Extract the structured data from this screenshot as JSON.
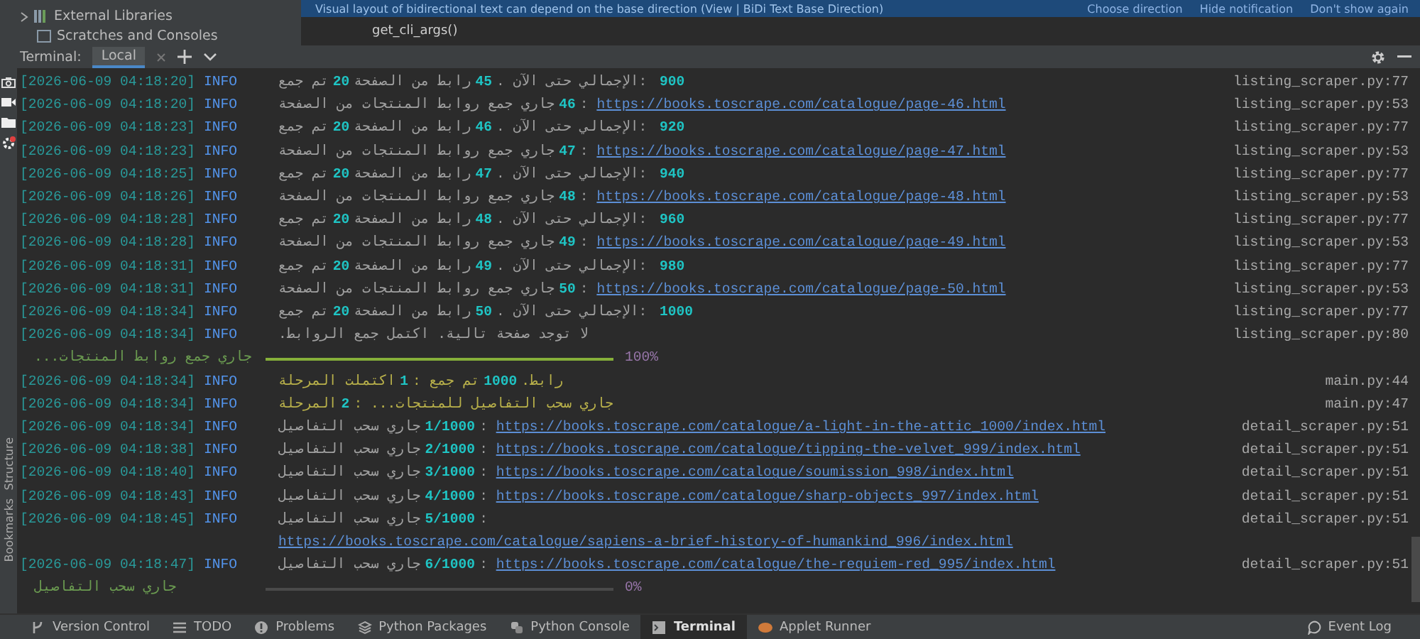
{
  "notification": {
    "text": "Visual layout of bidirectional text can depend on the base direction (View | BiDi Text Base Direction)",
    "actions": [
      "Choose direction",
      "Hide notification",
      "Don't show again"
    ]
  },
  "project_tree": {
    "items": [
      {
        "label": "External Libraries",
        "kind": "library"
      },
      {
        "label": "Scratches and Consoles",
        "kind": "scratch"
      }
    ]
  },
  "editor": {
    "code_line": "get_cli_args()"
  },
  "side_strip": {
    "tool_windows": [
      {
        "label": "Structure"
      },
      {
        "label": "Bookmarks"
      }
    ]
  },
  "terminal": {
    "title": "Terminal:",
    "tabs": [
      {
        "label": "Local",
        "selected": true
      }
    ],
    "log": [
      {
        "kind": "log",
        "highlighted": false,
        "time": "[2026-06-09 04:18:20]",
        "level": "INFO",
        "parts": [
          {
            "kind": "ar",
            "text": "تم جمع"
          },
          {
            "kind": "num",
            "text": "20"
          },
          {
            "kind": "ar",
            "text": "رابط من الصفحة"
          },
          {
            "kind": "num",
            "text": "45"
          },
          {
            "kind": "plain",
            "text": ". "
          },
          {
            "kind": "ar",
            "text": "الإجمالي حتى الآن"
          },
          {
            "kind": "plain",
            "text": ": "
          },
          {
            "kind": "num",
            "text": "900"
          }
        ],
        "source": "listing_scraper.py:77"
      },
      {
        "kind": "log",
        "highlighted": false,
        "time": "[2026-06-09 04:18:20]",
        "level": "INFO",
        "parts": [
          {
            "kind": "ar",
            "text": "جاري جمع روابط المنتجات من الصفحة"
          },
          {
            "kind": "num",
            "text": "46"
          },
          {
            "kind": "plain",
            "text": ": "
          },
          {
            "kind": "url",
            "text": "https://books.toscrape.com/catalogue/page-46.html"
          }
        ],
        "source": "listing_scraper.py:53"
      },
      {
        "kind": "log",
        "highlighted": false,
        "time": "[2026-06-09 04:18:23]",
        "level": "INFO",
        "parts": [
          {
            "kind": "ar",
            "text": "تم جمع"
          },
          {
            "kind": "num",
            "text": "20"
          },
          {
            "kind": "ar",
            "text": "رابط من الصفحة"
          },
          {
            "kind": "num",
            "text": "46"
          },
          {
            "kind": "plain",
            "text": ". "
          },
          {
            "kind": "ar",
            "text": "الإجمالي حتى الآن"
          },
          {
            "kind": "plain",
            "text": ": "
          },
          {
            "kind": "num",
            "text": "920"
          }
        ],
        "source": "listing_scraper.py:77"
      },
      {
        "kind": "log",
        "highlighted": false,
        "time": "[2026-06-09 04:18:23]",
        "level": "INFO",
        "parts": [
          {
            "kind": "ar",
            "text": "جاري جمع روابط المنتجات من الصفحة"
          },
          {
            "kind": "num",
            "text": "47"
          },
          {
            "kind": "plain",
            "text": ": "
          },
          {
            "kind": "url",
            "text": "https://books.toscrape.com/catalogue/page-47.html"
          }
        ],
        "source": "listing_scraper.py:53"
      },
      {
        "kind": "log",
        "highlighted": false,
        "time": "[2026-06-09 04:18:25]",
        "level": "INFO",
        "parts": [
          {
            "kind": "ar",
            "text": "تم جمع"
          },
          {
            "kind": "num",
            "text": "20"
          },
          {
            "kind": "ar",
            "text": "رابط من الصفحة"
          },
          {
            "kind": "num",
            "text": "47"
          },
          {
            "kind": "plain",
            "text": ". "
          },
          {
            "kind": "ar",
            "text": "الإجمالي حتى الآن"
          },
          {
            "kind": "plain",
            "text": ": "
          },
          {
            "kind": "num",
            "text": "940"
          }
        ],
        "source": "listing_scraper.py:77"
      },
      {
        "kind": "log",
        "highlighted": false,
        "time": "[2026-06-09 04:18:26]",
        "level": "INFO",
        "parts": [
          {
            "kind": "ar",
            "text": "جاري جمع روابط المنتجات من الصفحة"
          },
          {
            "kind": "num",
            "text": "48"
          },
          {
            "kind": "plain",
            "text": ": "
          },
          {
            "kind": "url",
            "text": "https://books.toscrape.com/catalogue/page-48.html"
          }
        ],
        "source": "listing_scraper.py:53"
      },
      {
        "kind": "log",
        "highlighted": false,
        "time": "[2026-06-09 04:18:28]",
        "level": "INFO",
        "parts": [
          {
            "kind": "ar",
            "text": "تم جمع"
          },
          {
            "kind": "num",
            "text": "20"
          },
          {
            "kind": "ar",
            "text": "رابط من الصفحة"
          },
          {
            "kind": "num",
            "text": "48"
          },
          {
            "kind": "plain",
            "text": ". "
          },
          {
            "kind": "ar",
            "text": "الإجمالي حتى الآن"
          },
          {
            "kind": "plain",
            "text": ": "
          },
          {
            "kind": "num",
            "text": "960"
          }
        ],
        "source": "listing_scraper.py:77"
      },
      {
        "kind": "log",
        "highlighted": false,
        "time": "[2026-06-09 04:18:28]",
        "level": "INFO",
        "parts": [
          {
            "kind": "ar",
            "text": "جاري جمع روابط المنتجات من الصفحة"
          },
          {
            "kind": "num",
            "text": "49"
          },
          {
            "kind": "plain",
            "text": ": "
          },
          {
            "kind": "url",
            "text": "https://books.toscrape.com/catalogue/page-49.html"
          }
        ],
        "source": "listing_scraper.py:53"
      },
      {
        "kind": "log",
        "highlighted": false,
        "time": "[2026-06-09 04:18:31]",
        "level": "INFO",
        "parts": [
          {
            "kind": "ar",
            "text": "تم جمع"
          },
          {
            "kind": "num",
            "text": "20"
          },
          {
            "kind": "ar",
            "text": "رابط من الصفحة"
          },
          {
            "kind": "num",
            "text": "49"
          },
          {
            "kind": "plain",
            "text": ". "
          },
          {
            "kind": "ar",
            "text": "الإجمالي حتى الآن"
          },
          {
            "kind": "plain",
            "text": ": "
          },
          {
            "kind": "num",
            "text": "980"
          }
        ],
        "source": "listing_scraper.py:77"
      },
      {
        "kind": "log",
        "highlighted": false,
        "time": "[2026-06-09 04:18:31]",
        "level": "INFO",
        "parts": [
          {
            "kind": "ar",
            "text": "جاري جمع روابط المنتجات من الصفحة"
          },
          {
            "kind": "num",
            "text": "50"
          },
          {
            "kind": "plain",
            "text": ": "
          },
          {
            "kind": "url",
            "text": "https://books.toscrape.com/catalogue/page-50.html"
          }
        ],
        "source": "listing_scraper.py:53"
      },
      {
        "kind": "log",
        "highlighted": false,
        "time": "[2026-06-09 04:18:34]",
        "level": "INFO",
        "parts": [
          {
            "kind": "ar",
            "text": "تم جمع"
          },
          {
            "kind": "num",
            "text": "20"
          },
          {
            "kind": "ar",
            "text": "رابط من الصفحة"
          },
          {
            "kind": "num",
            "text": "50"
          },
          {
            "kind": "plain",
            "text": ". "
          },
          {
            "kind": "ar",
            "text": "الإجمالي حتى الآن"
          },
          {
            "kind": "plain",
            "text": ": "
          },
          {
            "kind": "num",
            "text": "1000"
          }
        ],
        "source": "listing_scraper.py:77"
      },
      {
        "kind": "log",
        "highlighted": false,
        "time": "[2026-06-09 04:18:34]",
        "level": "INFO",
        "parts": [
          {
            "kind": "ar",
            "text": "لا توجد صفحة تالية. اكتمل جمع الروابط."
          }
        ],
        "source": "listing_scraper.py:80"
      },
      {
        "kind": "progress",
        "label": "جاري جمع روابط المنتجات...",
        "level": 1,
        "percent": "100%"
      },
      {
        "kind": "log",
        "highlighted": true,
        "time": "[2026-06-09 04:18:34]",
        "level": "INFO",
        "parts": [
          {
            "kind": "ar",
            "text": "اكتملت المرحلة"
          },
          {
            "kind": "num",
            "text": "1"
          },
          {
            "kind": "plain",
            "text": ": "
          },
          {
            "kind": "ar",
            "text": "تم جمع"
          },
          {
            "kind": "num",
            "text": "1000"
          },
          {
            "kind": "ar",
            "text": "رابط."
          }
        ],
        "source": "main.py:44"
      },
      {
        "kind": "log",
        "highlighted": true,
        "time": "[2026-06-09 04:18:34]",
        "level": "INFO",
        "parts": [
          {
            "kind": "ar",
            "text": "المرحلة"
          },
          {
            "kind": "num",
            "text": "2"
          },
          {
            "kind": "plain",
            "text": ": "
          },
          {
            "kind": "ar",
            "text": "جاري سحب التفاصيل للمنتجات..."
          }
        ],
        "source": "main.py:47"
      },
      {
        "kind": "log",
        "highlighted": false,
        "time": "[2026-06-09 04:18:34]",
        "level": "INFO",
        "parts": [
          {
            "kind": "ar",
            "text": "جاري سحب التفاصيل"
          },
          {
            "kind": "num",
            "text": "1/1000"
          },
          {
            "kind": "plain",
            "text": ": "
          },
          {
            "kind": "url",
            "text": "https://books.toscrape.com/catalogue/a-light-in-the-attic_1000/index.html"
          }
        ],
        "source": "detail_scraper.py:51"
      },
      {
        "kind": "log",
        "highlighted": false,
        "time": "[2026-06-09 04:18:38]",
        "level": "INFO",
        "parts": [
          {
            "kind": "ar",
            "text": "جاري سحب التفاصيل"
          },
          {
            "kind": "num",
            "text": "2/1000"
          },
          {
            "kind": "plain",
            "text": ": "
          },
          {
            "kind": "url",
            "text": "https://books.toscrape.com/catalogue/tipping-the-velvet_999/index.html"
          }
        ],
        "source": "detail_scraper.py:51"
      },
      {
        "kind": "log",
        "highlighted": false,
        "time": "[2026-06-09 04:18:40]",
        "level": "INFO",
        "parts": [
          {
            "kind": "ar",
            "text": "جاري سحب التفاصيل"
          },
          {
            "kind": "num",
            "text": "3/1000"
          },
          {
            "kind": "plain",
            "text": ": "
          },
          {
            "kind": "url",
            "text": "https://books.toscrape.com/catalogue/soumission_998/index.html"
          }
        ],
        "source": "detail_scraper.py:51"
      },
      {
        "kind": "log",
        "highlighted": false,
        "time": "[2026-06-09 04:18:43]",
        "level": "INFO",
        "parts": [
          {
            "kind": "ar",
            "text": "جاري سحب التفاصيل"
          },
          {
            "kind": "num",
            "text": "4/1000"
          },
          {
            "kind": "plain",
            "text": ": "
          },
          {
            "kind": "url",
            "text": "https://books.toscrape.com/catalogue/sharp-objects_997/index.html"
          }
        ],
        "source": "detail_scraper.py:51"
      },
      {
        "kind": "log",
        "highlighted": false,
        "time": "[2026-06-09 04:18:45]",
        "level": "INFO",
        "parts": [
          {
            "kind": "ar",
            "text": "جاري سحب التفاصيل"
          },
          {
            "kind": "num",
            "text": "5/1000"
          },
          {
            "kind": "plain",
            "text": ": "
          },
          {
            "kind": "url",
            "text": "https://books.toscrape.com/catalogue/sapiens-a-brief-history-of-humankind_996/index.html"
          }
        ],
        "source": "detail_scraper.py:51"
      },
      {
        "kind": "log",
        "highlighted": false,
        "time": "[2026-06-09 04:18:47]",
        "level": "INFO",
        "parts": [
          {
            "kind": "ar",
            "text": "جاري سحب التفاصيل"
          },
          {
            "kind": "num",
            "text": "6/1000"
          },
          {
            "kind": "plain",
            "text": ": "
          },
          {
            "kind": "url",
            "text": "https://books.toscrape.com/catalogue/the-requiem-red_995/index.html"
          }
        ],
        "source": "detail_scraper.py:51"
      },
      {
        "kind": "progress",
        "label": "جاري سحب التفاصيل",
        "level": 0,
        "percent": "0%"
      }
    ]
  },
  "tool_tabs": [
    {
      "label": "Version Control",
      "kind": "vcs",
      "selected": false
    },
    {
      "label": "TODO",
      "kind": "todo",
      "selected": false
    },
    {
      "label": "Problems",
      "kind": "problems",
      "selected": false
    },
    {
      "label": "Python Packages",
      "kind": "packages",
      "selected": false
    },
    {
      "label": "Python Console",
      "kind": "console",
      "selected": false
    },
    {
      "label": "Terminal",
      "kind": "terminal",
      "selected": true
    },
    {
      "label": "Applet Runner",
      "kind": "applet",
      "selected": false
    }
  ],
  "event_log": "Event Log"
}
